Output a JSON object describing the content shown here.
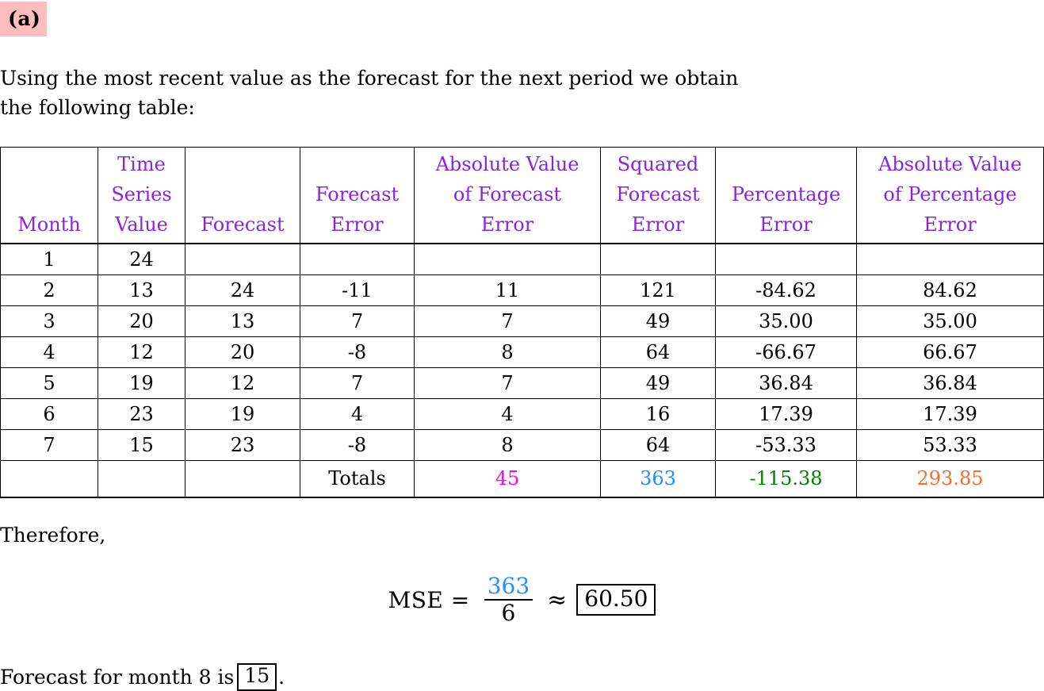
{
  "part": {
    "label": "(a)"
  },
  "intro": {
    "line1": "Using the most recent value as the forecast for the next period we obtain",
    "line2": "the following table:"
  },
  "table": {
    "headers": [
      {
        "lines": [
          "Month"
        ]
      },
      {
        "lines": [
          "Time",
          "Series",
          "Value"
        ]
      },
      {
        "lines": [
          "Forecast"
        ]
      },
      {
        "lines": [
          "Forecast",
          "Error"
        ]
      },
      {
        "lines": [
          "Absolute Value",
          "of Forecast",
          "Error"
        ]
      },
      {
        "lines": [
          "Squared",
          "Forecast",
          "Error"
        ]
      },
      {
        "lines": [
          "Percentage",
          "Error"
        ]
      },
      {
        "lines": [
          "Absolute Value",
          "of Percentage",
          "Error"
        ]
      }
    ],
    "rows": [
      {
        "month": "1",
        "value": "24",
        "forecast": "",
        "error": "",
        "abs_error": "",
        "sq_error": "",
        "pct_error": "",
        "abs_pct_error": ""
      },
      {
        "month": "2",
        "value": "13",
        "forecast": "24",
        "error": "-11",
        "abs_error": "11",
        "sq_error": "121",
        "pct_error": "-84.62",
        "abs_pct_error": "84.62"
      },
      {
        "month": "3",
        "value": "20",
        "forecast": "13",
        "error": "7",
        "abs_error": "7",
        "sq_error": "49",
        "pct_error": "35.00",
        "abs_pct_error": "35.00"
      },
      {
        "month": "4",
        "value": "12",
        "forecast": "20",
        "error": "-8",
        "abs_error": "8",
        "sq_error": "64",
        "pct_error": "-66.67",
        "abs_pct_error": "66.67"
      },
      {
        "month": "5",
        "value": "19",
        "forecast": "12",
        "error": "7",
        "abs_error": "7",
        "sq_error": "49",
        "pct_error": "36.84",
        "abs_pct_error": "36.84"
      },
      {
        "month": "6",
        "value": "23",
        "forecast": "19",
        "error": "4",
        "abs_error": "4",
        "sq_error": "16",
        "pct_error": "17.39",
        "abs_pct_error": "17.39"
      },
      {
        "month": "7",
        "value": "15",
        "forecast": "23",
        "error": "-8",
        "abs_error": "8",
        "sq_error": "64",
        "pct_error": "-53.33",
        "abs_pct_error": "53.33"
      }
    ],
    "totals": {
      "label": "Totals",
      "abs_error": "45",
      "sq_error": "363",
      "pct_error": "-115.38",
      "abs_pct_error": "293.85"
    }
  },
  "therefore": {
    "text": "Therefore,"
  },
  "formula": {
    "lhs": "MSE =",
    "numerator": "363",
    "denominator": "6",
    "approx_symbol": "≈",
    "result": "60.50"
  },
  "final": {
    "prefix": "Forecast for month 8 is",
    "value": "15",
    "suffix": "."
  },
  "colors": {
    "header": "#8a22e6",
    "highlight": "#ffbcbc",
    "total_abs_error": "#ff00ff",
    "total_sq_error": "#1e90ff",
    "total_pct_error": "#008000",
    "total_abs_pct_error": "#f96c30"
  },
  "chart_data": {
    "type": "table",
    "title": "Naive (most recent value) forecast accuracy table",
    "categories": [
      "1",
      "2",
      "3",
      "4",
      "5",
      "6",
      "7"
    ],
    "series": [
      {
        "name": "Time Series Value",
        "values": [
          24,
          13,
          20,
          12,
          19,
          23,
          15
        ]
      },
      {
        "name": "Forecast",
        "values": [
          null,
          24,
          13,
          20,
          12,
          19,
          23
        ]
      },
      {
        "name": "Forecast Error",
        "values": [
          null,
          -11,
          7,
          -8,
          7,
          4,
          -8
        ]
      },
      {
        "name": "Absolute Value of Forecast Error",
        "values": [
          null,
          11,
          7,
          8,
          7,
          4,
          8
        ]
      },
      {
        "name": "Squared Forecast Error",
        "values": [
          null,
          121,
          49,
          64,
          49,
          16,
          64
        ]
      },
      {
        "name": "Percentage Error",
        "values": [
          null,
          -84.62,
          35.0,
          -66.67,
          36.84,
          17.39,
          -53.33
        ]
      },
      {
        "name": "Absolute Value of Percentage Error",
        "values": [
          null,
          84.62,
          35.0,
          66.67,
          36.84,
          17.39,
          53.33
        ]
      }
    ],
    "totals": {
      "abs_error": 45,
      "sq_error": 363,
      "pct_error": -115.38,
      "abs_pct_error": 293.85
    },
    "xlabel": "Month",
    "ylabel": "",
    "derived": {
      "MSE": 60.5,
      "n": 6,
      "next_forecast": 15
    }
  }
}
